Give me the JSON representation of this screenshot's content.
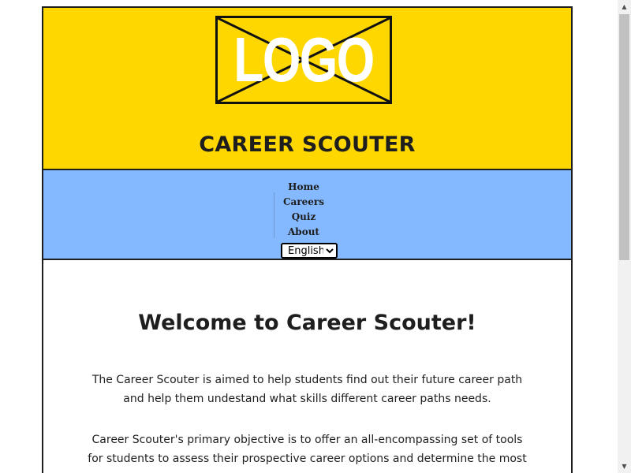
{
  "header": {
    "logo_text": "LOGO",
    "site_title": "CAREER SCOUTER"
  },
  "nav": {
    "items": [
      {
        "label": "Home"
      },
      {
        "label": "Careers"
      },
      {
        "label": "Quiz"
      },
      {
        "label": "About"
      }
    ],
    "language": {
      "selected": "English",
      "options": [
        "English"
      ]
    }
  },
  "main": {
    "heading": "Welcome to Career Scouter!",
    "paragraph1": "The Career Scouter is aimed to help students find out their future career path and help them undestand what skills different career paths needs.",
    "paragraph2": "Career Scouter's primary objective is to offer an all-encompassing set of tools for students to assess their prospective career options and determine the most"
  },
  "scrollbar": {
    "up_icon": "triangle-up",
    "down_icon": "triangle-down"
  },
  "colors": {
    "header_bg": "#fed700",
    "nav_bg": "#84b8ff",
    "border": "#1e1e1e",
    "text": "#1e1e1e"
  }
}
